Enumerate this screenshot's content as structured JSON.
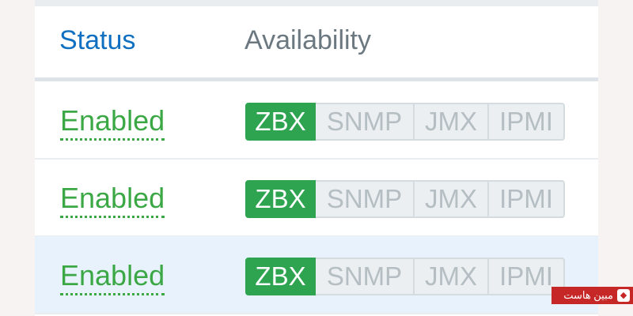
{
  "table": {
    "columns": {
      "status": "Status",
      "availability": "Availability"
    },
    "rows": [
      {
        "status": "Enabled",
        "badges": [
          "ZBX",
          "SNMP",
          "JMX",
          "IPMI"
        ],
        "selected": false
      },
      {
        "status": "Enabled",
        "badges": [
          "ZBX",
          "SNMP",
          "JMX",
          "IPMI"
        ],
        "selected": false
      },
      {
        "status": "Enabled",
        "badges": [
          "ZBX",
          "SNMP",
          "JMX",
          "IPMI"
        ],
        "selected": true
      }
    ]
  },
  "watermark": {
    "text": "مبین هاست"
  },
  "colors": {
    "status_enabled": "#3ba845",
    "header_link": "#0f6fc0",
    "zbx_active": "#2ea451",
    "badge_inactive": "#b4bec3",
    "selected_row": "#e7f2fd"
  }
}
